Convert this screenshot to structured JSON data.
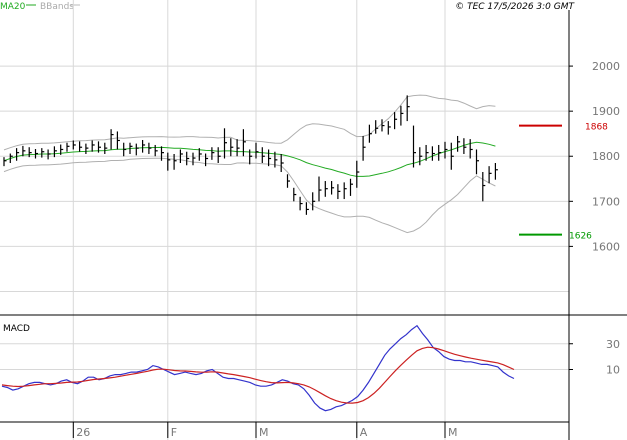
{
  "header": {
    "legend_ma": "MA20",
    "legend_bands": "BBands",
    "source": "© TEC 17/5/2026 3:0 GMT"
  },
  "colors": {
    "price": "#000000",
    "ma": "#22aa22",
    "bands": "#b0b0b0",
    "resistance": "#cc0000",
    "support": "#009900",
    "macd": "#3333cc",
    "signal": "#cc2222",
    "grid": "#d8d8d8"
  },
  "chart_data": [
    {
      "type": "line",
      "title": "",
      "series_names": [
        "MA20",
        "BBands"
      ],
      "y_ticks": [
        1600,
        1700,
        1800,
        1900,
        2000
      ],
      "ylim": [
        1450,
        2120
      ],
      "x_ticks": [
        {
          "label": "26",
          "index": 11
        },
        {
          "label": "F",
          "index": 26
        },
        {
          "label": "M",
          "index": 40
        },
        {
          "label": "A",
          "index": 56
        },
        {
          "label": "M",
          "index": 70
        }
      ],
      "resistance": {
        "label": "1868",
        "value": 1868
      },
      "support": {
        "label": "1626",
        "value": 1626
      },
      "bars": [
        [
          1798,
          1778,
          1790
        ],
        [
          1806,
          1785,
          1800
        ],
        [
          1818,
          1790,
          1808
        ],
        [
          1823,
          1800,
          1812
        ],
        [
          1820,
          1798,
          1808
        ],
        [
          1816,
          1795,
          1806
        ],
        [
          1818,
          1797,
          1810
        ],
        [
          1815,
          1793,
          1805
        ],
        [
          1822,
          1798,
          1812
        ],
        [
          1826,
          1803,
          1815
        ],
        [
          1830,
          1810,
          1822
        ],
        [
          1835,
          1815,
          1825
        ],
        [
          1833,
          1810,
          1820
        ],
        [
          1828,
          1805,
          1818
        ],
        [
          1835,
          1810,
          1825
        ],
        [
          1833,
          1808,
          1820
        ],
        [
          1830,
          1805,
          1818
        ],
        [
          1860,
          1815,
          1848
        ],
        [
          1855,
          1815,
          1835
        ],
        [
          1830,
          1800,
          1815
        ],
        [
          1830,
          1805,
          1822
        ],
        [
          1828,
          1802,
          1818
        ],
        [
          1836,
          1808,
          1825
        ],
        [
          1830,
          1805,
          1818
        ],
        [
          1825,
          1800,
          1812
        ],
        [
          1822,
          1790,
          1808
        ],
        [
          1808,
          1768,
          1792
        ],
        [
          1805,
          1770,
          1790
        ],
        [
          1815,
          1785,
          1805
        ],
        [
          1810,
          1780,
          1795
        ],
        [
          1808,
          1780,
          1796
        ],
        [
          1818,
          1790,
          1805
        ],
        [
          1806,
          1778,
          1795
        ],
        [
          1820,
          1792,
          1808
        ],
        [
          1820,
          1785,
          1800
        ],
        [
          1862,
          1795,
          1830
        ],
        [
          1840,
          1800,
          1820
        ],
        [
          1838,
          1800,
          1818
        ],
        [
          1860,
          1800,
          1832
        ],
        [
          1815,
          1782,
          1800
        ],
        [
          1830,
          1795,
          1810
        ],
        [
          1820,
          1785,
          1800
        ],
        [
          1815,
          1778,
          1795
        ],
        [
          1810,
          1775,
          1792
        ],
        [
          1805,
          1765,
          1785
        ],
        [
          1760,
          1730,
          1745
        ],
        [
          1730,
          1700,
          1715
        ],
        [
          1710,
          1680,
          1695
        ],
        [
          1698,
          1670,
          1682
        ],
        [
          1720,
          1680,
          1700
        ],
        [
          1755,
          1700,
          1725
        ],
        [
          1745,
          1710,
          1728
        ],
        [
          1745,
          1715,
          1730
        ],
        [
          1738,
          1705,
          1722
        ],
        [
          1742,
          1705,
          1728
        ],
        [
          1750,
          1712,
          1738
        ],
        [
          1790,
          1730,
          1765
        ],
        [
          1845,
          1790,
          1820
        ],
        [
          1870,
          1830,
          1850
        ],
        [
          1880,
          1850,
          1862
        ],
        [
          1882,
          1855,
          1868
        ],
        [
          1878,
          1848,
          1865
        ],
        [
          1898,
          1860,
          1882
        ],
        [
          1912,
          1868,
          1895
        ],
        [
          1935,
          1878,
          1910
        ],
        [
          1868,
          1775,
          1808
        ],
        [
          1820,
          1780,
          1800
        ],
        [
          1825,
          1790,
          1808
        ],
        [
          1822,
          1790,
          1806
        ],
        [
          1825,
          1790,
          1808
        ],
        [
          1832,
          1795,
          1815
        ],
        [
          1830,
          1770,
          1800
        ],
        [
          1845,
          1810,
          1832
        ],
        [
          1840,
          1805,
          1820
        ],
        [
          1838,
          1795,
          1815
        ],
        [
          1815,
          1760,
          1790
        ],
        [
          1765,
          1700,
          1735
        ],
        [
          1778,
          1740,
          1762
        ],
        [
          1785,
          1748,
          1770
        ]
      ]
    },
    {
      "type": "line",
      "title": "MACD",
      "y_ticks": [
        10,
        30
      ],
      "ylim": [
        -30,
        50
      ],
      "series": [
        {
          "name": "",
          "values": [
            -3,
            -4,
            -6,
            -5,
            -3,
            -1,
            0,
            0,
            -1,
            -2,
            -1,
            1,
            2,
            0,
            -1,
            1,
            4,
            4,
            2,
            3,
            5,
            6,
            6,
            7,
            8,
            8,
            9,
            10,
            13,
            12,
            10,
            8,
            6,
            7,
            8,
            7,
            6,
            7,
            9,
            10,
            7,
            4,
            3,
            3,
            2,
            1,
            0,
            -2,
            -3,
            -3,
            -2,
            0,
            2,
            1,
            -1,
            -2,
            -5,
            -10,
            -16,
            -20,
            -22,
            -21,
            -19,
            -18,
            -16,
            -14,
            -11,
            -6,
            0,
            7,
            14,
            21,
            26,
            30,
            34,
            37,
            41,
            44,
            38,
            33,
            27,
            24,
            20,
            18,
            17,
            17,
            16,
            16,
            15,
            14,
            14,
            13,
            12,
            8,
            5,
            3
          ]
        },
        {
          "name": "",
          "values": [
            -2,
            -2.5,
            -3,
            -3.2,
            -3,
            -2.5,
            -2,
            -1.5,
            -1,
            -1,
            -0.8,
            -0.5,
            0,
            0.2,
            0.3,
            0.8,
            1.5,
            2.2,
            2.6,
            3,
            3.5,
            4,
            4.8,
            5.6,
            6.3,
            7,
            7.8,
            8.6,
            9.6,
            10.2,
            10.2,
            9.8,
            9.2,
            8.9,
            8.8,
            8.5,
            8.1,
            7.9,
            8,
            8.2,
            8,
            7.3,
            6.6,
            6,
            5.3,
            4.5,
            3.6,
            2.5,
            1.4,
            0.5,
            -0.2,
            -0.4,
            -0.2,
            0,
            -0.4,
            -1,
            -2,
            -3.5,
            -5.6,
            -8,
            -10.4,
            -12.6,
            -14.2,
            -15.4,
            -16,
            -16.1,
            -15.6,
            -14.2,
            -11.8,
            -8.6,
            -4.6,
            0,
            4.6,
            9.1,
            13.3,
            17.2,
            21,
            24.5,
            26.4,
            27.3,
            26.9,
            25.9,
            24.6,
            23.1,
            21.8,
            20.7,
            19.7,
            18.8,
            18,
            17.2,
            16.5,
            15.8,
            15.1,
            13.7,
            11.9,
            10
          ]
        }
      ]
    }
  ]
}
